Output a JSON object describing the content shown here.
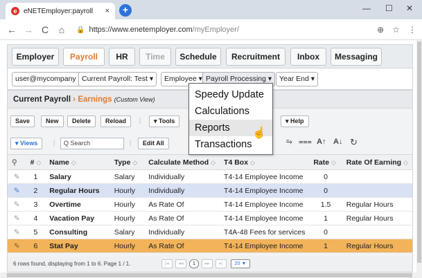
{
  "browser": {
    "tab_title": "eNETEmployer:payroll",
    "tab_close": "×",
    "new_tab": "+",
    "url_host": "https://www.enetemployer.com",
    "url_path": "/myEmployer/",
    "zoom_icon": "⊕",
    "star_icon": "☆",
    "menu_icon": "⋮",
    "minimize": "—",
    "maximize": "☐",
    "close": "✕"
  },
  "main_tabs": [
    {
      "label": "Employer",
      "state": "normal"
    },
    {
      "label": "Payroll",
      "state": "active"
    },
    {
      "label": "HR",
      "state": "normal"
    },
    {
      "label": "Time",
      "state": "disabled"
    },
    {
      "label": "Schedule",
      "state": "normal"
    },
    {
      "label": "Recruitment",
      "state": "normal"
    },
    {
      "label": "Inbox",
      "state": "normal"
    },
    {
      "label": "Messaging",
      "state": "normal"
    }
  ],
  "filters": {
    "user": "user@mycompany ▾",
    "payroll": "Current Payroll: Test ▾",
    "employee": "Employee ▾",
    "processing": "Payroll Processing ▾",
    "yearend": "Year End ▾"
  },
  "panel": {
    "title": "Current Payroll",
    "separator": "›",
    "section": "Earnings",
    "view": "(Custom View)"
  },
  "toolbar": {
    "save": "Save",
    "new": "New",
    "delete": "Delete",
    "reload": "Reload",
    "tools": "▾ Tools",
    "help": "▾ Help",
    "views": "▾ Views",
    "search_placeholder": "Q Search",
    "edit_all": "Edit All",
    "sep": "|"
  },
  "format_icons": {
    "wrap": "⥱",
    "clear": "⩶",
    "font_up": "A↑",
    "font_down": "A↓",
    "refresh": "↻"
  },
  "table": {
    "headers": [
      "",
      "#",
      "Name",
      "Type",
      "Calculate Method",
      "T4 Box",
      "Rate",
      "Rate Of Earning"
    ],
    "sort_icon": "◇",
    "rows": [
      {
        "n": "1",
        "name": "Salary",
        "type": "Salary",
        "method": "Individually",
        "box": "T4-14 Employee Income",
        "rate": "0",
        "roe": ""
      },
      {
        "n": "2",
        "name": "Regular Hours",
        "type": "Hourly",
        "method": "Individually",
        "box": "T4-14 Employee Income",
        "rate": "0",
        "roe": ""
      },
      {
        "n": "3",
        "name": "Overtime",
        "type": "Hourly",
        "method": "As Rate Of",
        "box": "T4-14 Employee Income",
        "rate": "1.5",
        "roe": "Regular Hours"
      },
      {
        "n": "4",
        "name": "Vacation Pay",
        "type": "Hourly",
        "method": "As Rate Of",
        "box": "T4-14 Employee Income",
        "rate": "1",
        "roe": "Regular Hours"
      },
      {
        "n": "5",
        "name": "Consulting",
        "type": "Salary",
        "method": "Individually",
        "box": "T4A-48 Fees for services",
        "rate": "0",
        "roe": ""
      },
      {
        "n": "6",
        "name": "Stat Pay",
        "type": "Hourly",
        "method": "As Rate Of",
        "box": "T4-14 Employee Income",
        "rate": "1",
        "roe": "Regular Hours"
      }
    ]
  },
  "footer": {
    "status": "6 rows found, displaying from 1 to 6. Page 1 / 1.",
    "first": "|◂",
    "prev": "◂◂",
    "page": "1",
    "next": "▸▸",
    "last": "▸|",
    "page_size": "20 ▼"
  },
  "dropdown_menu": {
    "items": [
      "Speedy Update",
      "Calculations",
      "Reports",
      "Transactions"
    ],
    "hovered": "Reports"
  },
  "colors": {
    "accent": "#e07b30",
    "selected_row": "#d9e1f5",
    "highlight_row": "#f2b35a"
  }
}
